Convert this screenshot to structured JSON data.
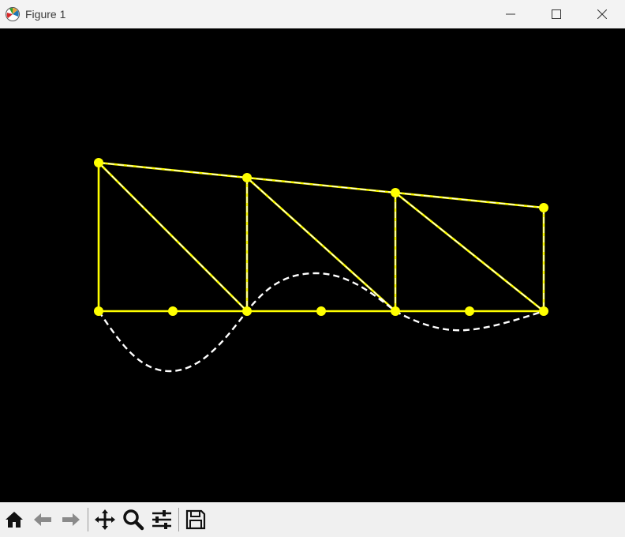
{
  "window": {
    "title": "Figure 1",
    "app_icon": "matplotlib-icon",
    "controls": [
      "minimize-icon",
      "maximize-icon",
      "close-icon"
    ]
  },
  "figure": {
    "background": "#000000",
    "member_color": "#ffff00",
    "deflection_color": "#ffffff",
    "members": [
      [
        0,
        1
      ],
      [
        1,
        2
      ],
      [
        2,
        3
      ],
      [
        3,
        4
      ],
      [
        4,
        5
      ],
      [
        5,
        6
      ],
      [
        0,
        7
      ],
      [
        7,
        8
      ],
      [
        8,
        9
      ],
      [
        9,
        10
      ],
      [
        7,
        2
      ],
      [
        8,
        2
      ],
      [
        8,
        4
      ],
      [
        9,
        4
      ],
      [
        9,
        6
      ],
      [
        10,
        6
      ]
    ],
    "deflected_shape": "dashed white line",
    "nodes_count": 11
  },
  "toolbar": {
    "buttons": [
      "home-icon",
      "back-icon",
      "forward-icon",
      "pan-icon",
      "zoom-icon",
      "configure-subplots-icon",
      "save-icon"
    ]
  }
}
